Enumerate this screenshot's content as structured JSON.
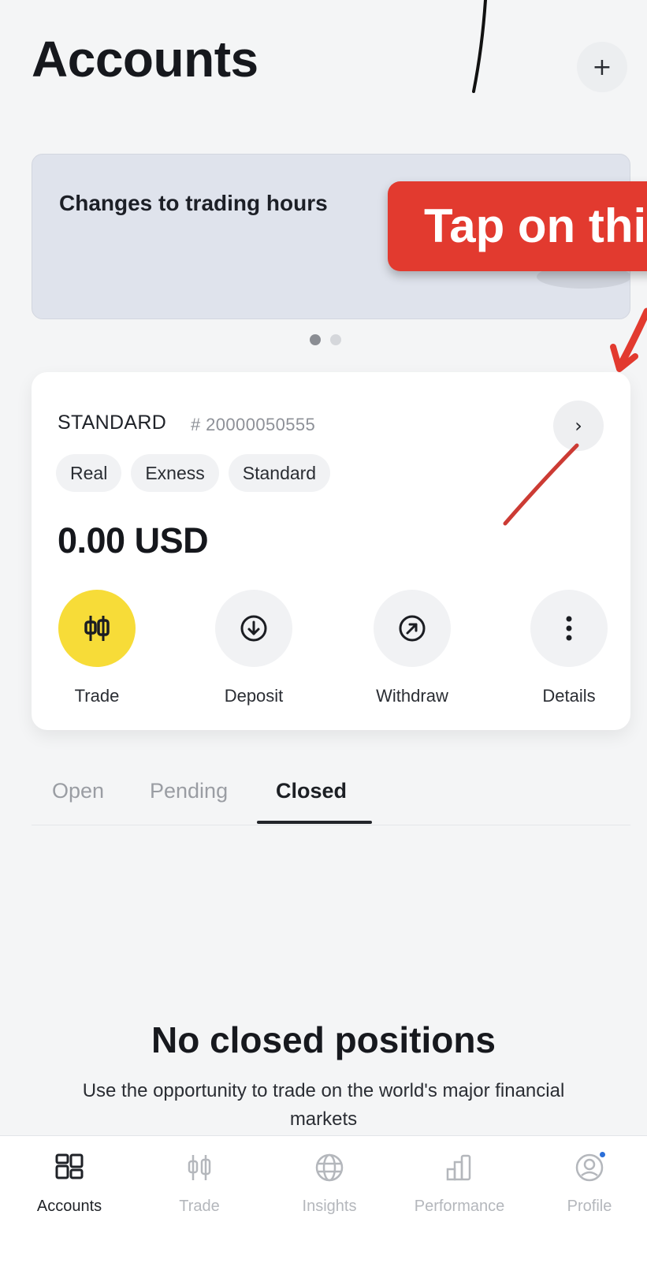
{
  "header": {
    "title": "Accounts",
    "add_symbol": "+"
  },
  "banner": {
    "text": "Changes to trading hours",
    "page_count": 2,
    "active_page": 1
  },
  "callout": {
    "text": "Tap on thi",
    "color": "#e23a2f"
  },
  "account": {
    "type": "STANDARD",
    "number": "# 20000050555",
    "tags": [
      "Real",
      "Exness",
      "Standard"
    ],
    "balance": "0.00 USD",
    "actions": [
      {
        "label": "Trade",
        "icon": "candlestick-icon",
        "highlight": true
      },
      {
        "label": "Deposit",
        "icon": "arrow-down-circle-icon",
        "highlight": false
      },
      {
        "label": "Withdraw",
        "icon": "arrow-up-right-circle-icon",
        "highlight": false
      },
      {
        "label": "Details",
        "icon": "more-vertical-icon",
        "highlight": false
      }
    ]
  },
  "tabs": {
    "items": [
      "Open",
      "Pending",
      "Closed"
    ],
    "active": "Closed"
  },
  "empty_state": {
    "title": "No closed positions",
    "description": "Use the opportunity to trade on the world's major financial markets"
  },
  "bottom_nav": {
    "items": [
      {
        "label": "Accounts",
        "icon": "grid-icon",
        "active": true
      },
      {
        "label": "Trade",
        "icon": "candlestick-icon",
        "active": false
      },
      {
        "label": "Insights",
        "icon": "globe-icon",
        "active": false
      },
      {
        "label": "Performance",
        "icon": "bar-chart-icon",
        "active": false
      },
      {
        "label": "Profile",
        "icon": "profile-icon",
        "active": false,
        "notification": true
      }
    ]
  },
  "colors": {
    "accent_yellow": "#f7dc38",
    "annotation_red": "#e23a2f",
    "notification_blue": "#2b6fd8"
  }
}
